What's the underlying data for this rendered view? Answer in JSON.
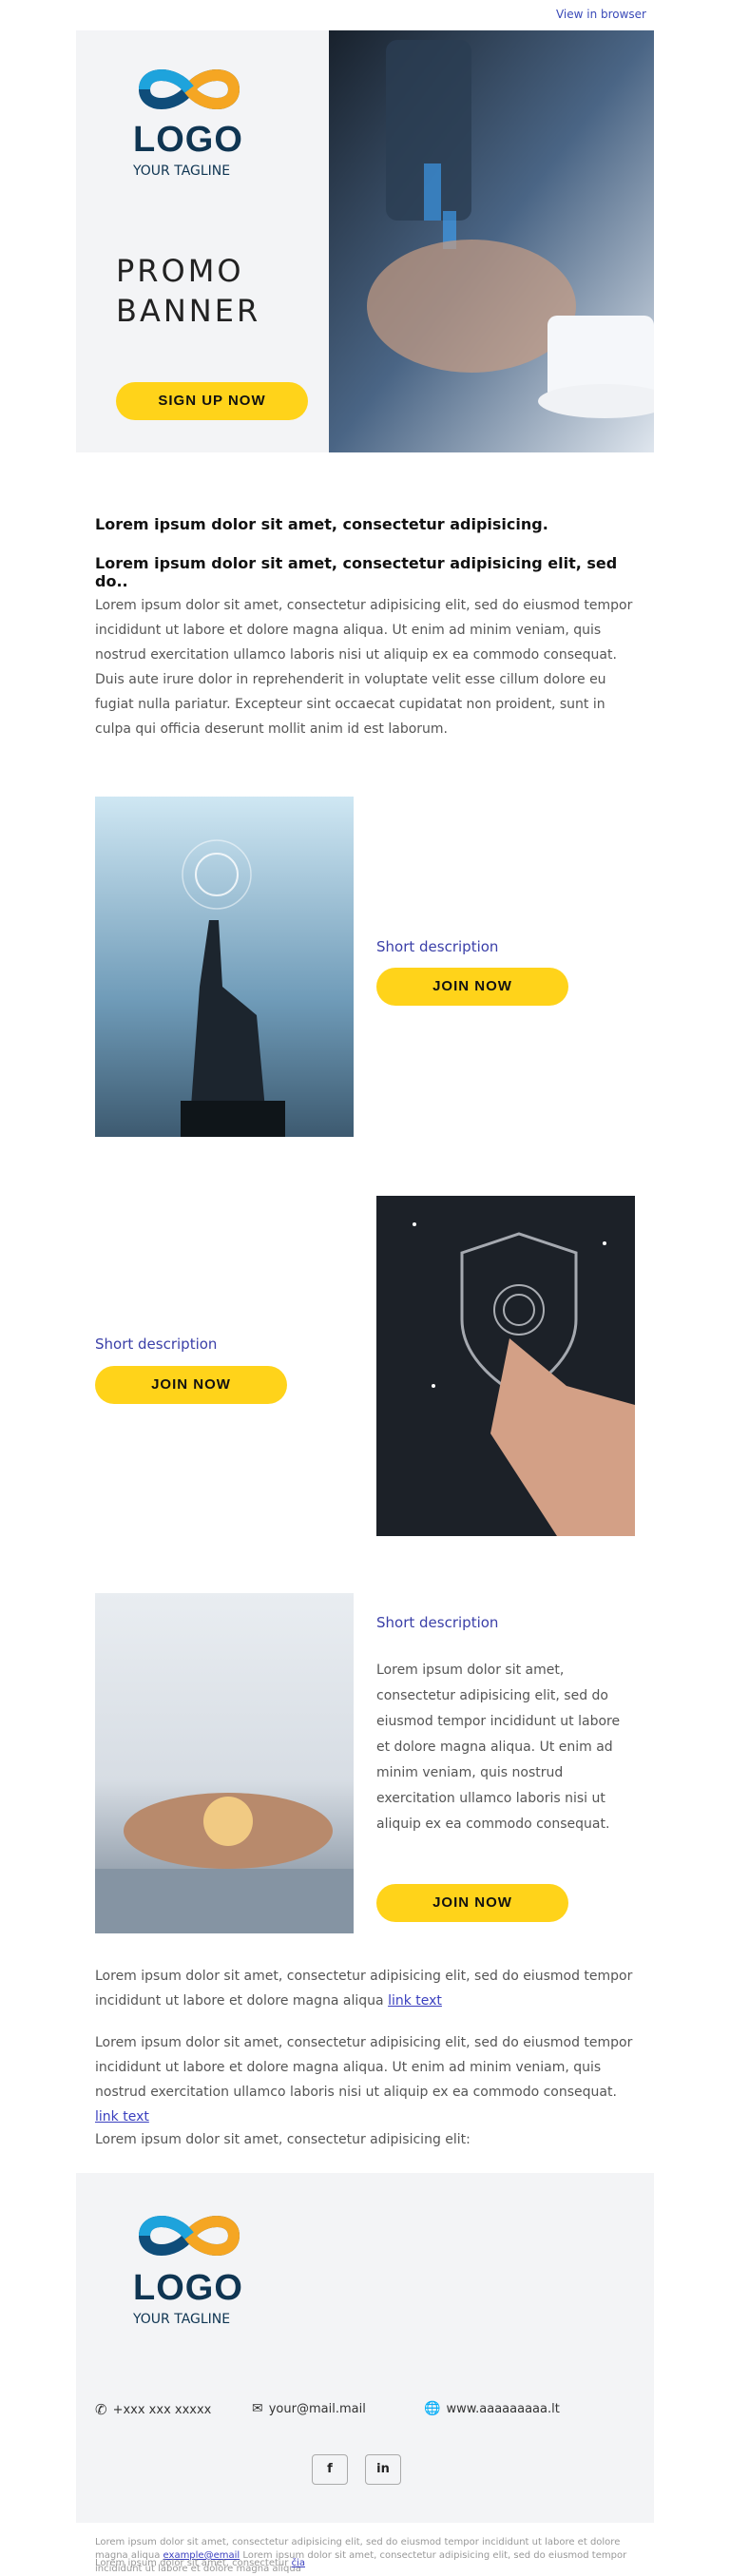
{
  "header": {
    "view_in_browser": "View in browser"
  },
  "hero": {
    "logo_text": "LOGO",
    "tagline": "YOUR TAGLINE",
    "promo_line1": "PROMO",
    "promo_line2": "BANNER",
    "cta": "SIGN UP NOW"
  },
  "intro": {
    "lead1": "Lorem ipsum dolor sit amet, consectetur adipisicing.",
    "lead2": "Lorem ipsum dolor sit amet, consectetur adipisicing elit, sed do..",
    "body": "Lorem ipsum dolor sit amet, consectetur adipisicing elit, sed do eiusmod tempor incididunt ut labore et dolore magna aliqua. Ut enim ad minim veniam, quis nostrud exercitation ullamco laboris nisi ut aliquip ex ea commodo consequat. Duis aute irure dolor in reprehenderit in voluptate velit esse cillum dolore eu fugiat nulla pariatur. Excepteur sint occaecat cupidatat non proident, sunt in culpa qui officia deserunt mollit anim id est laborum."
  },
  "block1": {
    "desc": "Short description",
    "cta": "JOIN NOW"
  },
  "block2": {
    "desc": "Short description",
    "cta": "JOIN NOW"
  },
  "block3": {
    "desc": "Short description",
    "body": "Lorem ipsum dolor sit amet, consectetur adipisicing elit, sed do eiusmod tempor incididunt ut labore et dolore magna aliqua. Ut enim ad minim veniam, quis nostrud exercitation ullamco laboris nisi ut aliquip ex ea commodo consequat.",
    "cta": "JOIN NOW"
  },
  "outro": {
    "p1": "Lorem ipsum dolor sit amet, consectetur adipisicing elit, sed do eiusmod tempor incididunt ut labore et dolore magna aliqua",
    "p1_link": "link text",
    "p2": "Lorem ipsum dolor sit amet, consectetur adipisicing elit, sed do eiusmod tempor incididunt ut labore et dolore magna aliqua. Ut enim ad minim veniam, quis nostrud exercitation ullamco laboris nisi ut aliquip ex ea commodo consequat.",
    "p2_link": "link text",
    "p3": "Lorem ipsum dolor sit amet, consectetur adipisicing elit:"
  },
  "footer": {
    "logo_text": "LOGO",
    "tagline": "YOUR TAGLINE",
    "phone": "+xxx xxx xxxxx",
    "email": "your@mail.mail",
    "website": "www.aaaaaaaaa.lt",
    "social": [
      "f",
      "in"
    ],
    "legal_pre": "Lorem ipsum dolor sit amet, consectetur adipisicing elit, sed do eiusmod tempor incididunt ut labore et dolore magna aliqua",
    "legal_email": "example@email",
    "legal_post": "Lorem ipsum dolor sit amet, consectetur adipisicing elit, sed do eiusmod tempor incididunt ut labore et dolore magna aliqua",
    "legal2_pre": "Lorem ipsum dolor sit amet, consectetur",
    "legal2_link": "čia"
  },
  "colors": {
    "accent": "#ffd31a",
    "brand": "#0f3552",
    "link": "#3a3fbf",
    "footer_bg": "#f3f4f6"
  }
}
